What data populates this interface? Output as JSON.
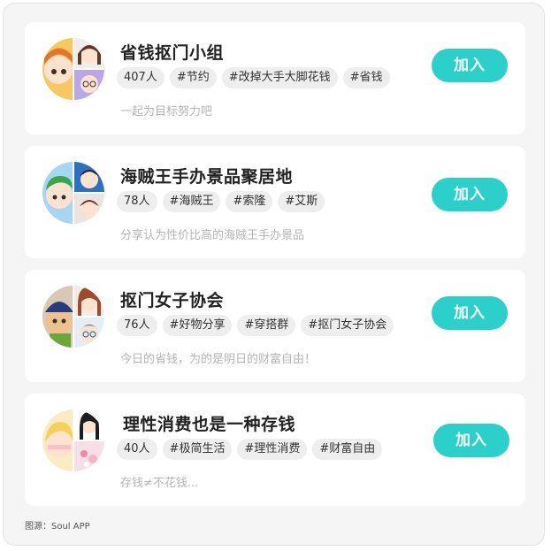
{
  "groups": [
    {
      "name": "省钱抠门小组",
      "tags": [
        "407人",
        "#节约",
        "#改掉大手大脚花钱",
        "#省钱"
      ],
      "description": "一起为目标努力吧",
      "join_label": "加入"
    },
    {
      "name": "海贼王手办景品聚居地",
      "tags": [
        "78人",
        "#海贼王",
        "#索隆",
        "#艾斯"
      ],
      "description": "分享认为性价比高的海贼王手办景品",
      "join_label": "加入"
    },
    {
      "name": "抠门女子协会",
      "tags": [
        "76人",
        "#好物分享",
        "#穿搭群",
        "#抠门女子协会"
      ],
      "description": "今日的省钱，为的是明日的财富自由！",
      "join_label": "加入"
    },
    {
      "name": "理性消费也是一种存钱",
      "tags": [
        "40人",
        "#极简生活",
        "#理性消费",
        "#财富自由"
      ],
      "description": "存钱≠不花钱...",
      "join_label": "加入"
    }
  ],
  "credit": "图源：Soul APP",
  "colors": {
    "accent": "#2bd0cb",
    "card": "#ffffff",
    "background": "#f5f5f6",
    "tag_bg": "#eeeeef"
  }
}
